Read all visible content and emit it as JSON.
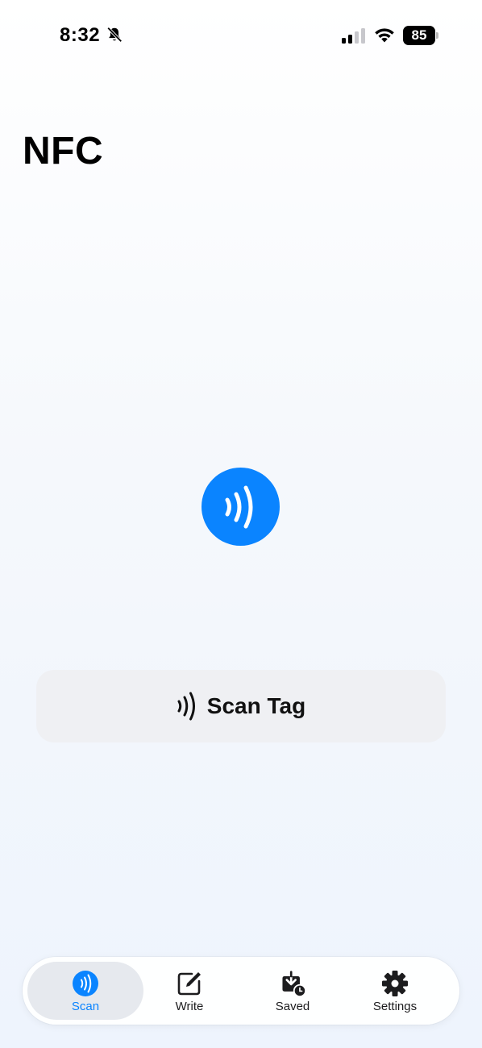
{
  "status_bar": {
    "time": "8:32",
    "battery": "85",
    "icons": [
      "bell-slash-icon",
      "cellular-signal-icon",
      "wifi-icon",
      "battery-icon"
    ]
  },
  "header": {
    "title": "NFC"
  },
  "main": {
    "center_icon": "nfc-waves-icon",
    "scan_button_label": "Scan Tag",
    "scan_button_icon": "nfc-waves-icon"
  },
  "tab_bar": {
    "tabs": [
      {
        "label": "Scan",
        "icon": "nfc-waves-icon",
        "selected": true
      },
      {
        "label": "Write",
        "icon": "square-pencil-icon",
        "selected": false
      },
      {
        "label": "Saved",
        "icon": "tray-download-clock-icon",
        "selected": false
      },
      {
        "label": "Settings",
        "icon": "gear-icon",
        "selected": false
      }
    ]
  },
  "colors": {
    "accent": "#0a84ff",
    "button_bg": "#eff0f3",
    "tab_selected_bg": "#e6e9ee"
  }
}
